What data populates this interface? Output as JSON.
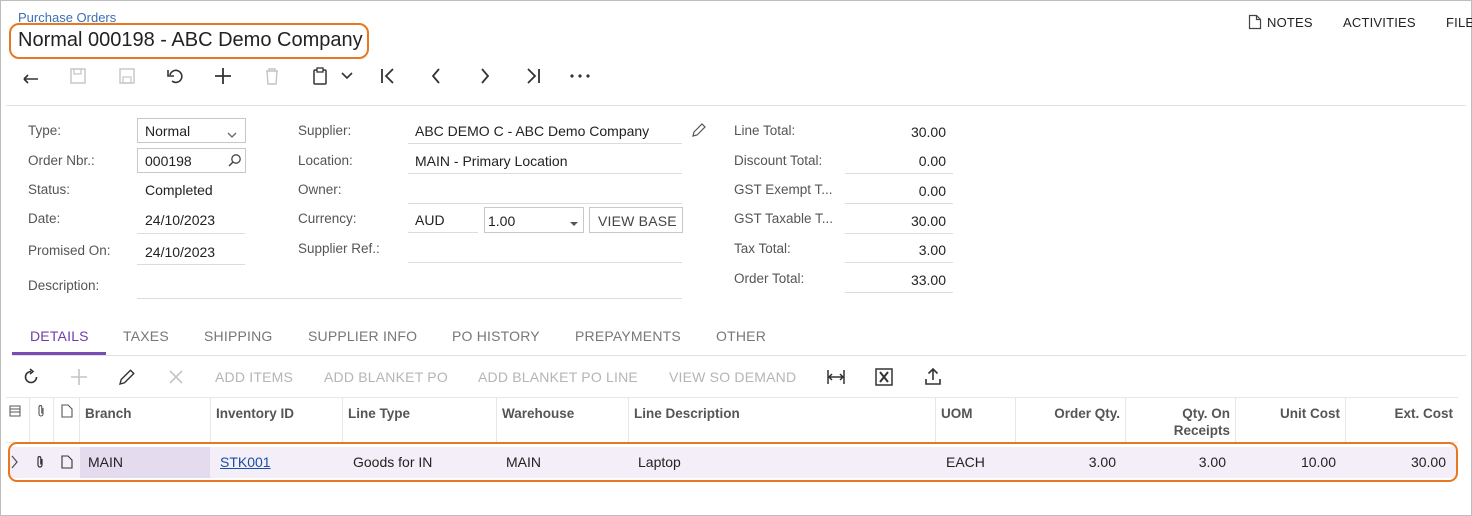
{
  "header": {
    "breadcrumb": "Purchase Orders",
    "title": "Normal 000198 - ABC Demo Company",
    "links": {
      "notes": "NOTES",
      "activities": "ACTIVITIES",
      "files": "FILE"
    }
  },
  "toolbar": {
    "icons": [
      "undo-icon",
      "save-close-icon",
      "save-icon",
      "cancel-icon",
      "add-icon",
      "delete-icon",
      "copy-paste-icon",
      "first-icon",
      "prev-icon",
      "next-icon",
      "last-icon",
      "more-icon"
    ]
  },
  "form": {
    "type_label": "Type:",
    "type_value": "Normal",
    "order_nbr_label": "Order Nbr.:",
    "order_nbr_value": "000198",
    "status_label": "Status:",
    "status_value": "Completed",
    "date_label": "Date:",
    "date_value": "24/10/2023",
    "promised_label": "Promised On:",
    "promised_value": "24/10/2023",
    "description_label": "Description:",
    "description_value": "",
    "supplier_label": "Supplier:",
    "supplier_value": "ABC DEMO C - ABC Demo Company",
    "location_label": "Location:",
    "location_value": "MAIN - Primary Location",
    "owner_label": "Owner:",
    "owner_value": "",
    "currency_label": "Currency:",
    "currency_value": "AUD",
    "rate_value": "1.00",
    "view_base_label": "VIEW BASE",
    "supplier_ref_label": "Supplier Ref.:",
    "supplier_ref_value": ""
  },
  "totals": {
    "line_total_label": "Line Total:",
    "line_total": "30.00",
    "discount_total_label": "Discount Total:",
    "discount_total": "0.00",
    "gst_exempt_label": "GST Exempt T...",
    "gst_exempt": "0.00",
    "gst_taxable_label": "GST Taxable T...",
    "gst_taxable": "30.00",
    "tax_total_label": "Tax Total:",
    "tax_total": "3.00",
    "order_total_label": "Order Total:",
    "order_total": "33.00"
  },
  "tabs": [
    "DETAILS",
    "TAXES",
    "SHIPPING",
    "SUPPLIER INFO",
    "PO HISTORY",
    "PREPAYMENTS",
    "OTHER"
  ],
  "grid_toolbar": {
    "add_items": "ADD ITEMS",
    "add_blanket_po": "ADD BLANKET PO",
    "add_blanket_po_line": "ADD BLANKET PO LINE",
    "view_so_demand": "VIEW SO DEMAND"
  },
  "columns": {
    "branch": "Branch",
    "inventory_id": "Inventory ID",
    "line_type": "Line Type",
    "warehouse": "Warehouse",
    "line_description": "Line Description",
    "uom": "UOM",
    "order_qty": "Order Qty.",
    "qty_on_receipts_1": "Qty. On",
    "qty_on_receipts_2": "Receipts",
    "unit_cost": "Unit Cost",
    "ext_cost": "Ext. Cost"
  },
  "rows": [
    {
      "branch": "MAIN",
      "inventory_id": "STK001",
      "line_type": "Goods for IN",
      "warehouse": "MAIN",
      "line_description": "Laptop",
      "uom": "EACH",
      "order_qty": "3.00",
      "qty_on_receipts": "3.00",
      "unit_cost": "10.00",
      "ext_cost": "30.00"
    }
  ],
  "colors": {
    "accent": "#7b4bb5",
    "highlight": "#e87722",
    "link": "#3b6fb6"
  }
}
